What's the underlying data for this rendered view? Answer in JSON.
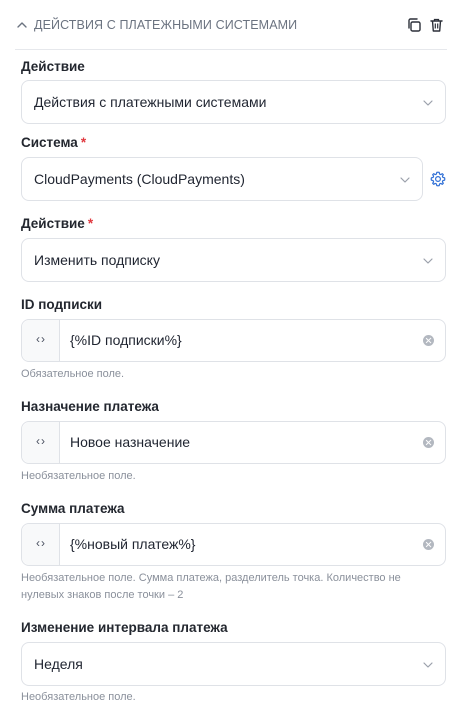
{
  "header": {
    "title": "ДЕЙСТВИЯ С ПЛАТЕЖНЫМИ СИСТЕМАМИ",
    "icons": [
      "chevron-up-icon",
      "copy-icon",
      "trash-icon"
    ]
  },
  "fields": {
    "action": {
      "label": "Действие",
      "value": "Действия с платежными системами"
    },
    "system": {
      "label": "Система",
      "required_mark": "*",
      "value": "CloudPayments (CloudPayments)"
    },
    "action2": {
      "label": "Действие",
      "required_mark": "*",
      "value": "Изменить подписку"
    },
    "subscription_id": {
      "label": "ID подписки",
      "value": "{%ID подписки%}",
      "prefix": "‹›",
      "hint": "Обязательное поле."
    },
    "purpose": {
      "label": "Назначение платежа",
      "value": "Новое назначение",
      "prefix": "‹›",
      "hint": "Необязательное поле."
    },
    "amount": {
      "label": "Сумма платежа",
      "value": "{%новый платеж%}",
      "prefix": "‹›",
      "hint": "Необязательное поле. Сумма платежа, разделитель точка. Количество не нулевых знаков после точки – 2"
    },
    "interval": {
      "label": "Изменение интервала платежа",
      "value": "Неделя",
      "hint": "Необязательное поле."
    }
  },
  "colors": {
    "required": "#e0383e",
    "accent": "#2f6fd6",
    "border": "#dfe2e7",
    "muted": "#8a909b"
  }
}
